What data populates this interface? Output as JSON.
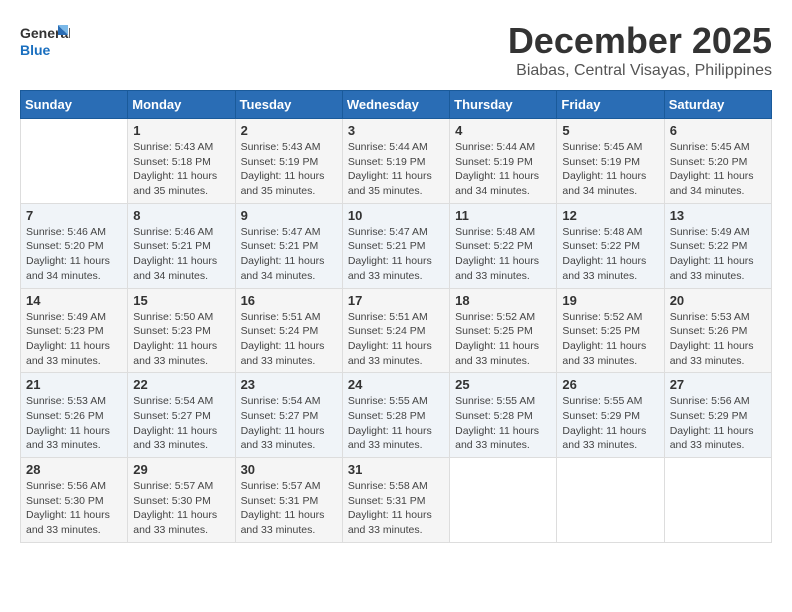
{
  "logo": {
    "text_general": "General",
    "text_blue": "Blue"
  },
  "title": "December 2025",
  "subtitle": "Biabas, Central Visayas, Philippines",
  "days_of_week": [
    "Sunday",
    "Monday",
    "Tuesday",
    "Wednesday",
    "Thursday",
    "Friday",
    "Saturday"
  ],
  "weeks": [
    [
      {
        "day": "",
        "info": ""
      },
      {
        "day": "1",
        "info": "Sunrise: 5:43 AM\nSunset: 5:18 PM\nDaylight: 11 hours\nand 35 minutes."
      },
      {
        "day": "2",
        "info": "Sunrise: 5:43 AM\nSunset: 5:19 PM\nDaylight: 11 hours\nand 35 minutes."
      },
      {
        "day": "3",
        "info": "Sunrise: 5:44 AM\nSunset: 5:19 PM\nDaylight: 11 hours\nand 35 minutes."
      },
      {
        "day": "4",
        "info": "Sunrise: 5:44 AM\nSunset: 5:19 PM\nDaylight: 11 hours\nand 34 minutes."
      },
      {
        "day": "5",
        "info": "Sunrise: 5:45 AM\nSunset: 5:19 PM\nDaylight: 11 hours\nand 34 minutes."
      },
      {
        "day": "6",
        "info": "Sunrise: 5:45 AM\nSunset: 5:20 PM\nDaylight: 11 hours\nand 34 minutes."
      }
    ],
    [
      {
        "day": "7",
        "info": "Sunrise: 5:46 AM\nSunset: 5:20 PM\nDaylight: 11 hours\nand 34 minutes."
      },
      {
        "day": "8",
        "info": "Sunrise: 5:46 AM\nSunset: 5:21 PM\nDaylight: 11 hours\nand 34 minutes."
      },
      {
        "day": "9",
        "info": "Sunrise: 5:47 AM\nSunset: 5:21 PM\nDaylight: 11 hours\nand 34 minutes."
      },
      {
        "day": "10",
        "info": "Sunrise: 5:47 AM\nSunset: 5:21 PM\nDaylight: 11 hours\nand 33 minutes."
      },
      {
        "day": "11",
        "info": "Sunrise: 5:48 AM\nSunset: 5:22 PM\nDaylight: 11 hours\nand 33 minutes."
      },
      {
        "day": "12",
        "info": "Sunrise: 5:48 AM\nSunset: 5:22 PM\nDaylight: 11 hours\nand 33 minutes."
      },
      {
        "day": "13",
        "info": "Sunrise: 5:49 AM\nSunset: 5:22 PM\nDaylight: 11 hours\nand 33 minutes."
      }
    ],
    [
      {
        "day": "14",
        "info": "Sunrise: 5:49 AM\nSunset: 5:23 PM\nDaylight: 11 hours\nand 33 minutes."
      },
      {
        "day": "15",
        "info": "Sunrise: 5:50 AM\nSunset: 5:23 PM\nDaylight: 11 hours\nand 33 minutes."
      },
      {
        "day": "16",
        "info": "Sunrise: 5:51 AM\nSunset: 5:24 PM\nDaylight: 11 hours\nand 33 minutes."
      },
      {
        "day": "17",
        "info": "Sunrise: 5:51 AM\nSunset: 5:24 PM\nDaylight: 11 hours\nand 33 minutes."
      },
      {
        "day": "18",
        "info": "Sunrise: 5:52 AM\nSunset: 5:25 PM\nDaylight: 11 hours\nand 33 minutes."
      },
      {
        "day": "19",
        "info": "Sunrise: 5:52 AM\nSunset: 5:25 PM\nDaylight: 11 hours\nand 33 minutes."
      },
      {
        "day": "20",
        "info": "Sunrise: 5:53 AM\nSunset: 5:26 PM\nDaylight: 11 hours\nand 33 minutes."
      }
    ],
    [
      {
        "day": "21",
        "info": "Sunrise: 5:53 AM\nSunset: 5:26 PM\nDaylight: 11 hours\nand 33 minutes."
      },
      {
        "day": "22",
        "info": "Sunrise: 5:54 AM\nSunset: 5:27 PM\nDaylight: 11 hours\nand 33 minutes."
      },
      {
        "day": "23",
        "info": "Sunrise: 5:54 AM\nSunset: 5:27 PM\nDaylight: 11 hours\nand 33 minutes."
      },
      {
        "day": "24",
        "info": "Sunrise: 5:55 AM\nSunset: 5:28 PM\nDaylight: 11 hours\nand 33 minutes."
      },
      {
        "day": "25",
        "info": "Sunrise: 5:55 AM\nSunset: 5:28 PM\nDaylight: 11 hours\nand 33 minutes."
      },
      {
        "day": "26",
        "info": "Sunrise: 5:55 AM\nSunset: 5:29 PM\nDaylight: 11 hours\nand 33 minutes."
      },
      {
        "day": "27",
        "info": "Sunrise: 5:56 AM\nSunset: 5:29 PM\nDaylight: 11 hours\nand 33 minutes."
      }
    ],
    [
      {
        "day": "28",
        "info": "Sunrise: 5:56 AM\nSunset: 5:30 PM\nDaylight: 11 hours\nand 33 minutes."
      },
      {
        "day": "29",
        "info": "Sunrise: 5:57 AM\nSunset: 5:30 PM\nDaylight: 11 hours\nand 33 minutes."
      },
      {
        "day": "30",
        "info": "Sunrise: 5:57 AM\nSunset: 5:31 PM\nDaylight: 11 hours\nand 33 minutes."
      },
      {
        "day": "31",
        "info": "Sunrise: 5:58 AM\nSunset: 5:31 PM\nDaylight: 11 hours\nand 33 minutes."
      },
      {
        "day": "",
        "info": ""
      },
      {
        "day": "",
        "info": ""
      },
      {
        "day": "",
        "info": ""
      }
    ]
  ]
}
